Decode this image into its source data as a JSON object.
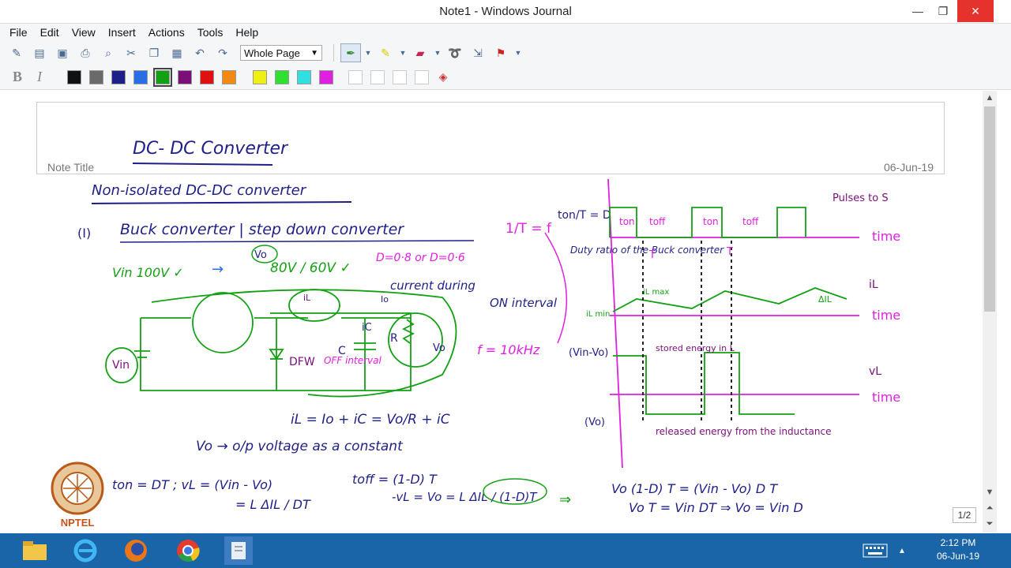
{
  "window": {
    "title": "Note1 - Windows Journal",
    "min": "—",
    "max": "❐",
    "close": "✕"
  },
  "menu": [
    "File",
    "Edit",
    "View",
    "Insert",
    "Actions",
    "Tools",
    "Help"
  ],
  "toolbar": {
    "zoom_value": "Whole Page"
  },
  "format": {
    "bold": "B",
    "italic": "I"
  },
  "colors": [
    "#111111",
    "#6a6a6a",
    "#1f1f8a",
    "#2a6ee6",
    "#14a014",
    "#7a0f7a",
    "#e01010",
    "#f08a10",
    "#f0f010",
    "#30e030",
    "#30e0e0",
    "#e020e0"
  ],
  "selected_color": "#14a014",
  "note": {
    "title_label": "Note Title",
    "date": "06-Jun-19",
    "heading": "DC- DC Converter"
  },
  "ink": {
    "l1": "Non-isolated DC-DC converter",
    "l2a": "(I)",
    "l2b": "Buck converter | step down converter",
    "l3a": "Vin 100V ✓",
    "l3b": "→",
    "l3c": "Vo",
    "l3d": "80V / 60V ✓",
    "l3e": "D=0·8 or D=0·6",
    "l4": "current during",
    "l5": "ON interval",
    "vin": "Vin",
    "dfw": "DFW",
    "offint": "OFF interval",
    "cap": "C",
    "res": "R",
    "vo": "Vo",
    "ic": "iC",
    "io": "Io",
    "il": "iL",
    "eq1": "iL = Io + iC  =  Vo/R + iC",
    "eq2": "Vo → o/p voltage as a constant",
    "ft": "1/T = f",
    "f": "f = 10kHz",
    "duty": "ton/T = D",
    "dutyr": "Duty ratio of the Buck converter",
    "ton": "ton",
    "toff": "toff",
    "T": "T",
    "pulses": "Pulses to S",
    "time": "time",
    "il_axis": "iL",
    "ilmax": "iL max",
    "ilmin": "iL min",
    "dil": "ΔIL",
    "vinvo": "(Vin-Vo)",
    "vo_lvl": "(Vo)",
    "vl": "vL",
    "stored": "stored energy in L",
    "released": "released energy from the inductance",
    "b1": "ton = DT ; vL = (Vin - Vo)",
    "b2": "= L ΔIL / DT",
    "b3": "toff = (1-D) T",
    "b4": "-vL = Vo = L ΔIL / (1-D)T",
    "b5": "⇒",
    "b6": "Vo (1-D) T = (Vin - Vo) D T",
    "b7": "Vo T = Vin DT ⇒ Vo = Vin D"
  },
  "nptel": "NPTEL",
  "page_indicator": "1/2",
  "clock": {
    "time": "2:12 PM",
    "date": "06-Jun-19"
  }
}
